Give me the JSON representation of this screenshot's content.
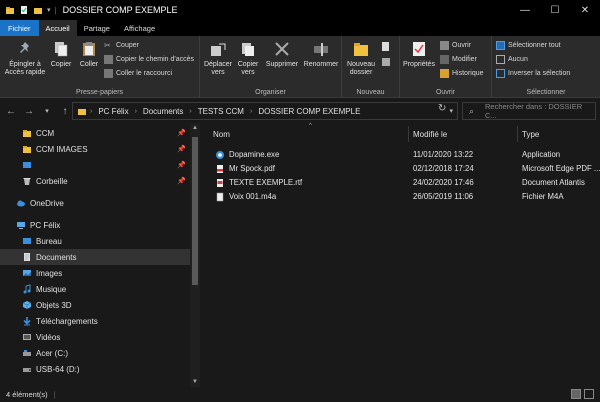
{
  "window": {
    "title": "DOSSIER COMP EXEMPLE"
  },
  "tabs": [
    {
      "label": "Fichier"
    },
    {
      "label": "Accueil"
    },
    {
      "label": "Partage"
    },
    {
      "label": "Affichage"
    }
  ],
  "ribbon": {
    "clipboard": {
      "pin_label_1": "Épingler à",
      "pin_label_2": "Accès rapide",
      "copy_label": "Copier",
      "paste_label": "Coller",
      "cut_label": "Couper",
      "copy_path_label": "Copier le chemin d'accès",
      "paste_shortcut_label": "Coller le raccourci",
      "group_label": "Presse-papiers"
    },
    "organize": {
      "move_label_1": "Déplacer",
      "move_label_2": "vers",
      "copyto_label_1": "Copier",
      "copyto_label_2": "vers",
      "delete_label": "Supprimer",
      "rename_label": "Renommer",
      "group_label": "Organiser"
    },
    "new": {
      "newfolder_label_1": "Nouveau",
      "newfolder_label_2": "dossier",
      "group_label": "Nouveau"
    },
    "open": {
      "properties_label": "Propriétés",
      "open_label": "Ouvrir",
      "edit_label": "Modifier",
      "history_label": "Historique",
      "group_label": "Ouvrir"
    },
    "select": {
      "select_all_label": "Sélectionner tout",
      "select_none_label": "Aucun",
      "invert_label": "Inverser la sélection",
      "group_label": "Sélectionner"
    }
  },
  "address": {
    "segments": [
      "PC Félix",
      "Documents",
      "TESTS CCM",
      "DOSSIER COMP EXEMPLE"
    ],
    "search_placeholder": "Rechercher dans : DOSSIER C..."
  },
  "sidebar": {
    "items": [
      {
        "label": "CCM",
        "pinned": true
      },
      {
        "label": "CCM IMAGES",
        "pinned": true
      },
      {
        "label": "",
        "pinned": true
      },
      {
        "label": "Corbeille",
        "pinned": true
      },
      {
        "label": "OneDrive"
      },
      {
        "label": "PC Félix"
      },
      {
        "label": "Bureau"
      },
      {
        "label": "Documents"
      },
      {
        "label": "Images"
      },
      {
        "label": "Musique"
      },
      {
        "label": "Objets 3D"
      },
      {
        "label": "Téléchargements"
      },
      {
        "label": "Vidéos"
      },
      {
        "label": "Acer (C:)"
      },
      {
        "label": "USB-64 (D:)"
      }
    ]
  },
  "columns": {
    "name": "Nom",
    "modified": "Modifié le",
    "type": "Type"
  },
  "files": [
    {
      "name": "Dopamine.exe",
      "modified": "11/01/2020 13:22",
      "type": "Application"
    },
    {
      "name": "Mr Spock.pdf",
      "modified": "02/12/2018 17:24",
      "type": "Microsoft Edge PDF ..."
    },
    {
      "name": "TEXTE EXEMPLE.rtf",
      "modified": "24/02/2020 17:46",
      "type": "Document Atlantis"
    },
    {
      "name": "Voix 001.m4a",
      "modified": "26/05/2019 11:06",
      "type": "Fichier M4A"
    }
  ],
  "status": {
    "count": "4 élément(s)"
  },
  "colors": {
    "accent": "#1a73c7",
    "folder": "#f0c040"
  }
}
